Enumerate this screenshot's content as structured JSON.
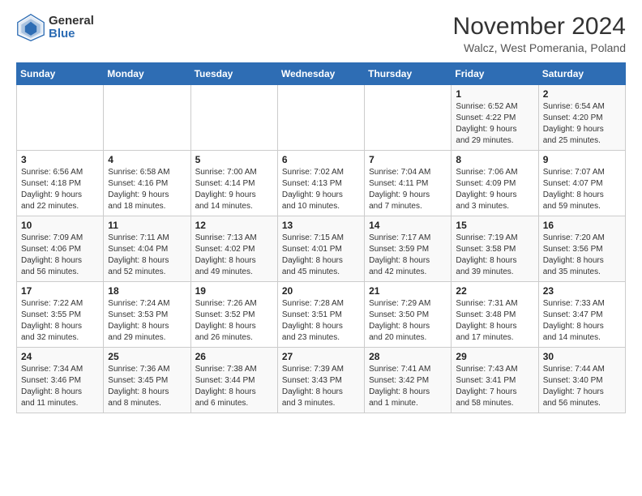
{
  "logo": {
    "general": "General",
    "blue": "Blue"
  },
  "header": {
    "title": "November 2024",
    "subtitle": "Walcz, West Pomerania, Poland"
  },
  "weekdays": [
    "Sunday",
    "Monday",
    "Tuesday",
    "Wednesday",
    "Thursday",
    "Friday",
    "Saturday"
  ],
  "weeks": [
    [
      {
        "day": "",
        "info": ""
      },
      {
        "day": "",
        "info": ""
      },
      {
        "day": "",
        "info": ""
      },
      {
        "day": "",
        "info": ""
      },
      {
        "day": "",
        "info": ""
      },
      {
        "day": "1",
        "info": "Sunrise: 6:52 AM\nSunset: 4:22 PM\nDaylight: 9 hours\nand 29 minutes."
      },
      {
        "day": "2",
        "info": "Sunrise: 6:54 AM\nSunset: 4:20 PM\nDaylight: 9 hours\nand 25 minutes."
      }
    ],
    [
      {
        "day": "3",
        "info": "Sunrise: 6:56 AM\nSunset: 4:18 PM\nDaylight: 9 hours\nand 22 minutes."
      },
      {
        "day": "4",
        "info": "Sunrise: 6:58 AM\nSunset: 4:16 PM\nDaylight: 9 hours\nand 18 minutes."
      },
      {
        "day": "5",
        "info": "Sunrise: 7:00 AM\nSunset: 4:14 PM\nDaylight: 9 hours\nand 14 minutes."
      },
      {
        "day": "6",
        "info": "Sunrise: 7:02 AM\nSunset: 4:13 PM\nDaylight: 9 hours\nand 10 minutes."
      },
      {
        "day": "7",
        "info": "Sunrise: 7:04 AM\nSunset: 4:11 PM\nDaylight: 9 hours\nand 7 minutes."
      },
      {
        "day": "8",
        "info": "Sunrise: 7:06 AM\nSunset: 4:09 PM\nDaylight: 9 hours\nand 3 minutes."
      },
      {
        "day": "9",
        "info": "Sunrise: 7:07 AM\nSunset: 4:07 PM\nDaylight: 8 hours\nand 59 minutes."
      }
    ],
    [
      {
        "day": "10",
        "info": "Sunrise: 7:09 AM\nSunset: 4:06 PM\nDaylight: 8 hours\nand 56 minutes."
      },
      {
        "day": "11",
        "info": "Sunrise: 7:11 AM\nSunset: 4:04 PM\nDaylight: 8 hours\nand 52 minutes."
      },
      {
        "day": "12",
        "info": "Sunrise: 7:13 AM\nSunset: 4:02 PM\nDaylight: 8 hours\nand 49 minutes."
      },
      {
        "day": "13",
        "info": "Sunrise: 7:15 AM\nSunset: 4:01 PM\nDaylight: 8 hours\nand 45 minutes."
      },
      {
        "day": "14",
        "info": "Sunrise: 7:17 AM\nSunset: 3:59 PM\nDaylight: 8 hours\nand 42 minutes."
      },
      {
        "day": "15",
        "info": "Sunrise: 7:19 AM\nSunset: 3:58 PM\nDaylight: 8 hours\nand 39 minutes."
      },
      {
        "day": "16",
        "info": "Sunrise: 7:20 AM\nSunset: 3:56 PM\nDaylight: 8 hours\nand 35 minutes."
      }
    ],
    [
      {
        "day": "17",
        "info": "Sunrise: 7:22 AM\nSunset: 3:55 PM\nDaylight: 8 hours\nand 32 minutes."
      },
      {
        "day": "18",
        "info": "Sunrise: 7:24 AM\nSunset: 3:53 PM\nDaylight: 8 hours\nand 29 minutes."
      },
      {
        "day": "19",
        "info": "Sunrise: 7:26 AM\nSunset: 3:52 PM\nDaylight: 8 hours\nand 26 minutes."
      },
      {
        "day": "20",
        "info": "Sunrise: 7:28 AM\nSunset: 3:51 PM\nDaylight: 8 hours\nand 23 minutes."
      },
      {
        "day": "21",
        "info": "Sunrise: 7:29 AM\nSunset: 3:50 PM\nDaylight: 8 hours\nand 20 minutes."
      },
      {
        "day": "22",
        "info": "Sunrise: 7:31 AM\nSunset: 3:48 PM\nDaylight: 8 hours\nand 17 minutes."
      },
      {
        "day": "23",
        "info": "Sunrise: 7:33 AM\nSunset: 3:47 PM\nDaylight: 8 hours\nand 14 minutes."
      }
    ],
    [
      {
        "day": "24",
        "info": "Sunrise: 7:34 AM\nSunset: 3:46 PM\nDaylight: 8 hours\nand 11 minutes."
      },
      {
        "day": "25",
        "info": "Sunrise: 7:36 AM\nSunset: 3:45 PM\nDaylight: 8 hours\nand 8 minutes."
      },
      {
        "day": "26",
        "info": "Sunrise: 7:38 AM\nSunset: 3:44 PM\nDaylight: 8 hours\nand 6 minutes."
      },
      {
        "day": "27",
        "info": "Sunrise: 7:39 AM\nSunset: 3:43 PM\nDaylight: 8 hours\nand 3 minutes."
      },
      {
        "day": "28",
        "info": "Sunrise: 7:41 AM\nSunset: 3:42 PM\nDaylight: 8 hours\nand 1 minute."
      },
      {
        "day": "29",
        "info": "Sunrise: 7:43 AM\nSunset: 3:41 PM\nDaylight: 7 hours\nand 58 minutes."
      },
      {
        "day": "30",
        "info": "Sunrise: 7:44 AM\nSunset: 3:40 PM\nDaylight: 7 hours\nand 56 minutes."
      }
    ]
  ]
}
